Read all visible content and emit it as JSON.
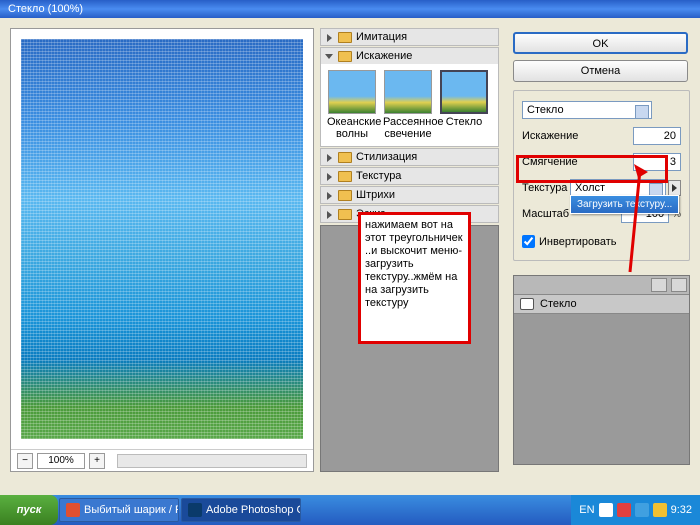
{
  "title": "Стекло (100%)",
  "zoom": "100%",
  "categories": {
    "c0": "Имитация",
    "c1": "Искажение",
    "c2": "Стилизация",
    "c3": "Текстура",
    "c4": "Штрихи",
    "c5": "Эскиз"
  },
  "thumbs": {
    "t0": "Океанские волны",
    "t1": "Рассеянное свечение",
    "t2": "Стекло"
  },
  "buttons": {
    "ok": "OK",
    "cancel": "Отмена"
  },
  "filter": {
    "name": "Стекло",
    "distortion_label": "Искажение",
    "distortion_value": "20",
    "smooth_label": "Смягчение",
    "smooth_value": "3",
    "texture_label": "Текстура",
    "texture_value": "Холст",
    "scale_label": "Масштаб",
    "scale_value": "100",
    "scale_pct": "%",
    "invert_label": "Инвертировать",
    "menu_load": "Загрузить текстуру..."
  },
  "layer_label": "Стекло",
  "annotation": "нажимаем вот на этот треугольничек ..и выскочит меню-загрузить текстуру..жмём на на загрузить текстуру",
  "taskbar": {
    "start": "пуск",
    "item1": "Выбитый шарик / Ph...",
    "item2": "Adobe Photoshop CS...",
    "lang": "EN",
    "time": "9:32"
  }
}
